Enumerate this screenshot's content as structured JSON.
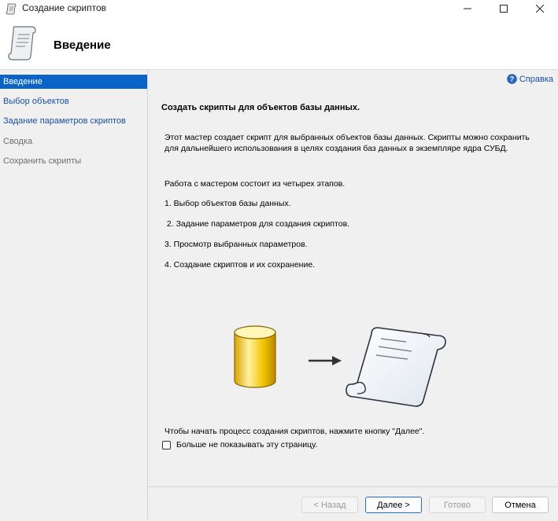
{
  "window": {
    "title": "Создание скриптов"
  },
  "header": {
    "title": "Введение"
  },
  "sidebar": {
    "items": [
      {
        "label": "Введение",
        "state": "active"
      },
      {
        "label": "Выбор объектов",
        "state": "link"
      },
      {
        "label": "Задание параметров скриптов",
        "state": "link"
      },
      {
        "label": "Сводка",
        "state": "disabled"
      },
      {
        "label": "Сохранить скрипты",
        "state": "disabled"
      }
    ]
  },
  "help": {
    "label": "Справка"
  },
  "content": {
    "heading": "Создать скрипты для объектов базы данных.",
    "intro": "Этот мастер создает скрипт для выбранных объектов базы данных. Скрипты можно сохранить для дальнейшего использования в целях создания баз данных в экземпляре ядра СУБД.",
    "steps_intro": "Работа с мастером состоит из четырех этапов.",
    "step1": "1. Выбор объектов базы данных.",
    "step2": " 2. Задание параметров для создания скриптов.",
    "step3": "3. Просмотр выбранных параметров.",
    "step4": "4. Создание скриптов и их сохранение.",
    "start_hint": "Чтобы начать процесс создания скриптов, нажмите кнопку \"Далее\".",
    "dont_show_label": "Больше не показывать эту страницу.",
    "dont_show_checked": false
  },
  "buttons": {
    "back": "< Назад",
    "next": "Далее >",
    "finish": "Готово",
    "cancel": "Отмена"
  },
  "colors": {
    "accent": "#0a64c8",
    "link": "#1a4ea0",
    "disabled_text": "#6d6d6d"
  }
}
